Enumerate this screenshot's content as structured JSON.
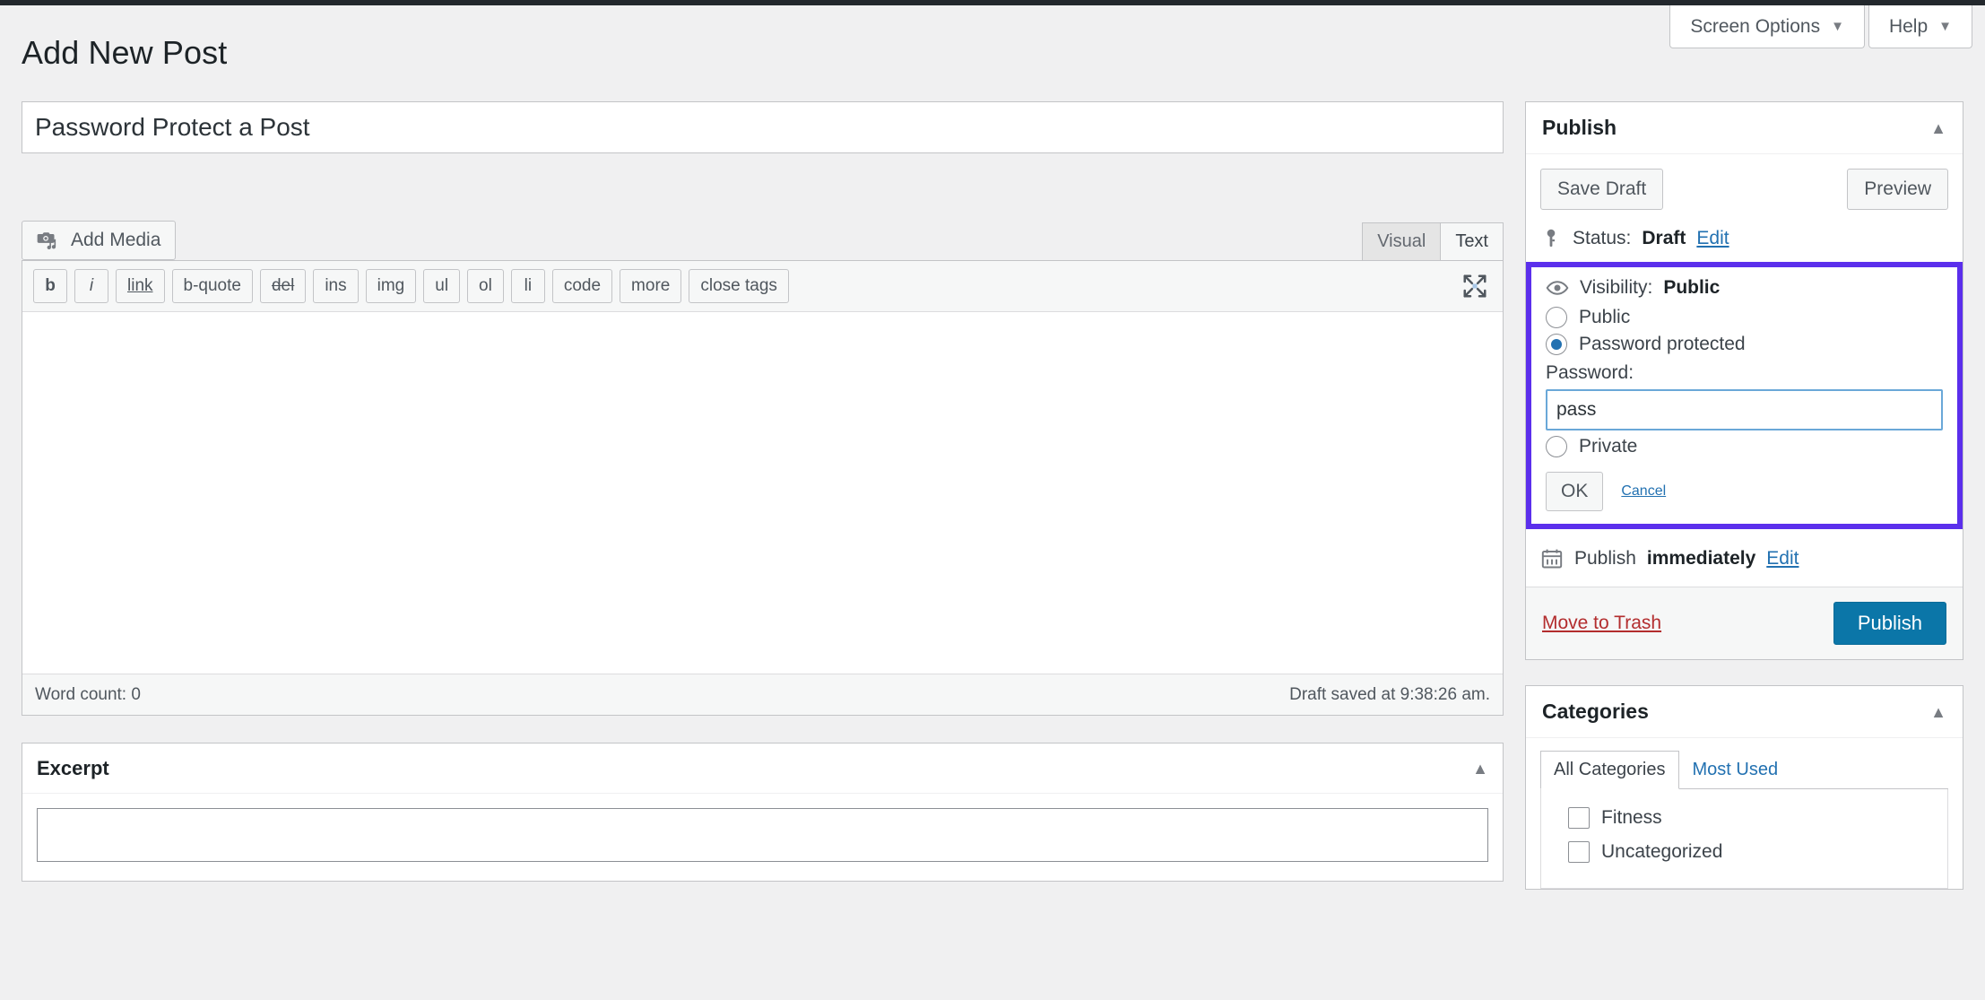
{
  "screen_meta": {
    "screen_options_label": "Screen Options",
    "help_label": "Help",
    "caret": "▼"
  },
  "page": {
    "title": "Add New Post"
  },
  "post": {
    "title_value": "Password Protect a Post",
    "title_placeholder": "Enter title here",
    "content_value": ""
  },
  "editor": {
    "add_media_label": "Add Media",
    "tabs": [
      {
        "label": "Visual",
        "active": false
      },
      {
        "label": "Text",
        "active": true
      }
    ],
    "quicktags": [
      {
        "label": "b",
        "style": "bold"
      },
      {
        "label": "i",
        "style": "italic"
      },
      {
        "label": "link",
        "style": "underline"
      },
      {
        "label": "b-quote",
        "style": ""
      },
      {
        "label": "del",
        "style": "strike"
      },
      {
        "label": "ins",
        "style": ""
      },
      {
        "label": "img",
        "style": ""
      },
      {
        "label": "ul",
        "style": ""
      },
      {
        "label": "ol",
        "style": ""
      },
      {
        "label": "li",
        "style": ""
      },
      {
        "label": "code",
        "style": ""
      },
      {
        "label": "more",
        "style": ""
      },
      {
        "label": "close tags",
        "style": ""
      }
    ],
    "word_count": "Word count: 0",
    "draft_saved": "Draft saved at 9:38:26 am."
  },
  "excerpt": {
    "title": "Excerpt",
    "toggle": "▲"
  },
  "publish": {
    "title": "Publish",
    "toggle": "▲",
    "save_draft_label": "Save Draft",
    "preview_label": "Preview",
    "status_prefix": "Status:",
    "status_value": "Draft",
    "status_edit_label": "Edit",
    "visibility_prefix": "Visibility:",
    "visibility_value": "Public",
    "options": [
      {
        "label": "Public",
        "checked": false
      },
      {
        "label": "Password protected",
        "checked": true
      }
    ],
    "password_label": "Password:",
    "password_value": "pass",
    "private_label": "Private",
    "private_checked": false,
    "ok_label": "OK",
    "cancel_label": "Cancel",
    "publish_date_prefix": "Publish",
    "publish_date_value": "immediately",
    "publish_date_edit_label": "Edit",
    "trash_label": "Move to Trash",
    "publish_label": "Publish"
  },
  "categories": {
    "title": "Categories",
    "toggle": "▲",
    "tabs": [
      {
        "label": "All Categories",
        "active": true
      },
      {
        "label": "Most Used",
        "active": false
      }
    ],
    "items": [
      {
        "label": "Fitness",
        "checked": false
      },
      {
        "label": "Uncategorized",
        "checked": false
      }
    ]
  },
  "colors": {
    "highlight_purple": "#5b2fec",
    "primary_blue": "#0b76a8",
    "link_blue": "#2271b1",
    "danger_red": "#b32d2e",
    "admin_dark": "#23282d"
  }
}
